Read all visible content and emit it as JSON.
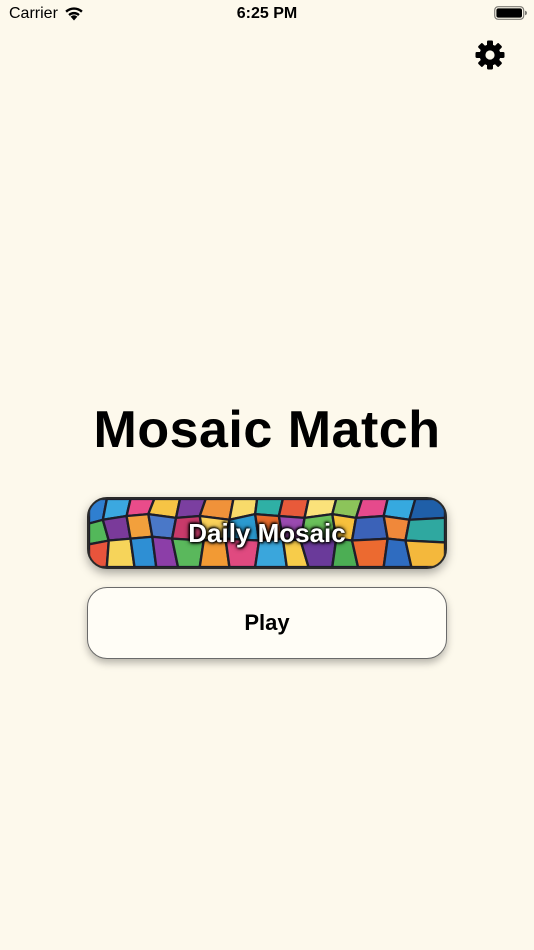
{
  "status_bar": {
    "carrier": "Carrier",
    "time": "6:25 PM"
  },
  "header": {
    "settings_icon": "gear-icon"
  },
  "main": {
    "title": "Mosaic Match",
    "daily_button_label": "Daily Mosaic",
    "play_button_label": "Play"
  },
  "colors": {
    "background": "#fdf9ec",
    "text": "#000000",
    "play_button_bg": "#fffdf6"
  }
}
